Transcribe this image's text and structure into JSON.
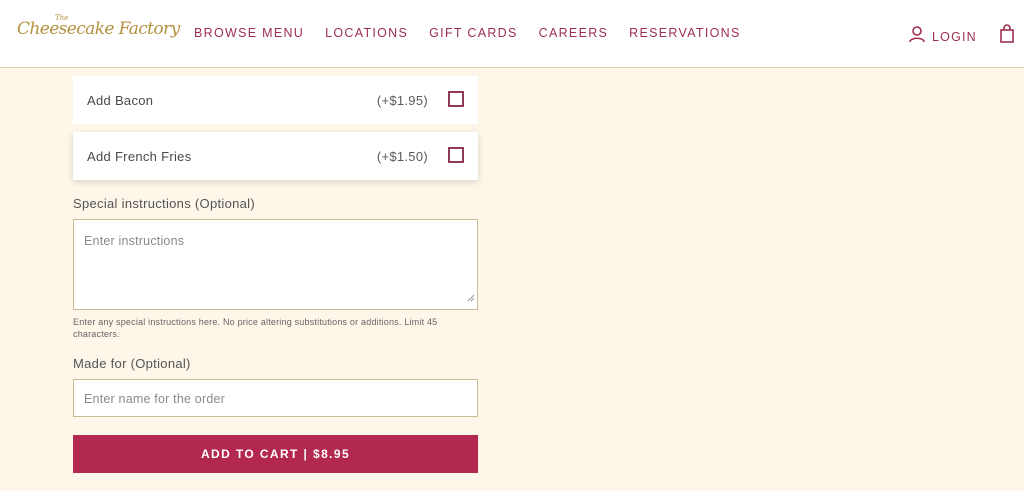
{
  "header": {
    "logo_the": "The",
    "logo_text": "Cheesecake Factory",
    "nav": [
      "BROWSE MENU",
      "LOCATIONS",
      "GIFT CARDS",
      "CAREERS",
      "RESERVATIONS"
    ],
    "login_label": "LOGIN",
    "icons": {
      "user": "user-icon",
      "bag": "shopping-bag-icon"
    }
  },
  "addons": [
    {
      "name": "Add Bacon",
      "price": "(+$1.95)",
      "checked": false
    },
    {
      "name": "Add French Fries",
      "price": "(+$1.50)",
      "checked": false
    }
  ],
  "special_instructions": {
    "label": "Special instructions (Optional)",
    "placeholder": "Enter instructions",
    "helper": "Enter any special instructions here. No price altering substitutions or additions. Limit 45 characters."
  },
  "made_for": {
    "label": "Made for (Optional)",
    "placeholder": "Enter name for the order"
  },
  "cta": {
    "label": "ADD TO CART | $8.95"
  },
  "colors": {
    "background": "#fdf6e9",
    "brand_gold": "#b3913e",
    "nav_text": "#9e2f4e",
    "button": "#b3284e",
    "checkbox_border": "#8e3a58"
  }
}
